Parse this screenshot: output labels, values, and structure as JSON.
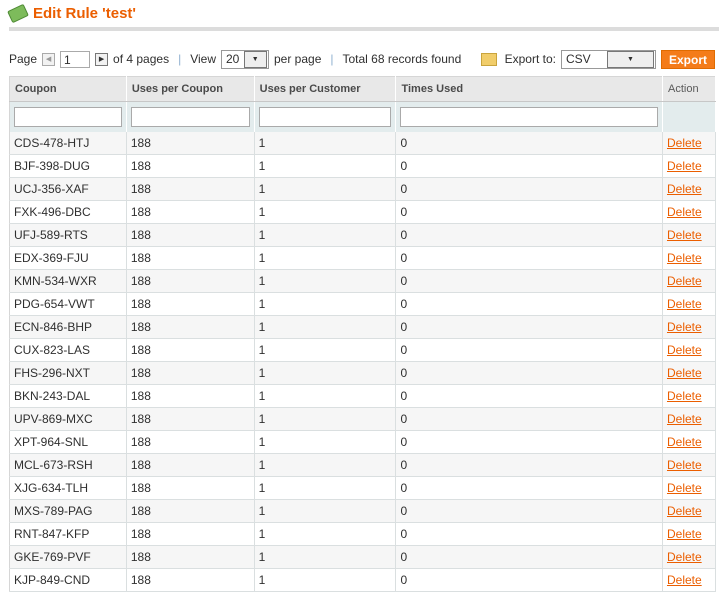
{
  "header": {
    "title": "Edit Rule 'test'",
    "icon": "money-icon"
  },
  "pager": {
    "page_label": "Page",
    "page_value": "1",
    "of_pages": "of 4 pages",
    "view_label": "View",
    "per_page_value": "20",
    "per_page_label": "per page",
    "total": "Total 68 records found",
    "export_label": "Export to:",
    "export_format": "CSV",
    "export_button": "Export"
  },
  "columns": [
    "Coupon",
    "Uses per Coupon",
    "Uses per Customer",
    "Times Used",
    "Action"
  ],
  "colors": {
    "accent": "#eb5e00",
    "button": "#f47c1a"
  },
  "rows": [
    {
      "coupon": "CDS-478-HTJ",
      "upc": "188",
      "upcu": "1",
      "used": "0",
      "action": "Delete"
    },
    {
      "coupon": "BJF-398-DUG",
      "upc": "188",
      "upcu": "1",
      "used": "0",
      "action": "Delete"
    },
    {
      "coupon": "UCJ-356-XAF",
      "upc": "188",
      "upcu": "1",
      "used": "0",
      "action": "Delete"
    },
    {
      "coupon": "FXK-496-DBC",
      "upc": "188",
      "upcu": "1",
      "used": "0",
      "action": "Delete"
    },
    {
      "coupon": "UFJ-589-RTS",
      "upc": "188",
      "upcu": "1",
      "used": "0",
      "action": "Delete"
    },
    {
      "coupon": "EDX-369-FJU",
      "upc": "188",
      "upcu": "1",
      "used": "0",
      "action": "Delete"
    },
    {
      "coupon": "KMN-534-WXR",
      "upc": "188",
      "upcu": "1",
      "used": "0",
      "action": "Delete"
    },
    {
      "coupon": "PDG-654-VWT",
      "upc": "188",
      "upcu": "1",
      "used": "0",
      "action": "Delete"
    },
    {
      "coupon": "ECN-846-BHP",
      "upc": "188",
      "upcu": "1",
      "used": "0",
      "action": "Delete"
    },
    {
      "coupon": "CUX-823-LAS",
      "upc": "188",
      "upcu": "1",
      "used": "0",
      "action": "Delete"
    },
    {
      "coupon": "FHS-296-NXT",
      "upc": "188",
      "upcu": "1",
      "used": "0",
      "action": "Delete"
    },
    {
      "coupon": "BKN-243-DAL",
      "upc": "188",
      "upcu": "1",
      "used": "0",
      "action": "Delete"
    },
    {
      "coupon": "UPV-869-MXC",
      "upc": "188",
      "upcu": "1",
      "used": "0",
      "action": "Delete"
    },
    {
      "coupon": "XPT-964-SNL",
      "upc": "188",
      "upcu": "1",
      "used": "0",
      "action": "Delete"
    },
    {
      "coupon": "MCL-673-RSH",
      "upc": "188",
      "upcu": "1",
      "used": "0",
      "action": "Delete"
    },
    {
      "coupon": "XJG-634-TLH",
      "upc": "188",
      "upcu": "1",
      "used": "0",
      "action": "Delete"
    },
    {
      "coupon": "MXS-789-PAG",
      "upc": "188",
      "upcu": "1",
      "used": "0",
      "action": "Delete"
    },
    {
      "coupon": "RNT-847-KFP",
      "upc": "188",
      "upcu": "1",
      "used": "0",
      "action": "Delete"
    },
    {
      "coupon": "GKE-769-PVF",
      "upc": "188",
      "upcu": "1",
      "used": "0",
      "action": "Delete"
    },
    {
      "coupon": "KJP-849-CND",
      "upc": "188",
      "upcu": "1",
      "used": "0",
      "action": "Delete"
    }
  ]
}
